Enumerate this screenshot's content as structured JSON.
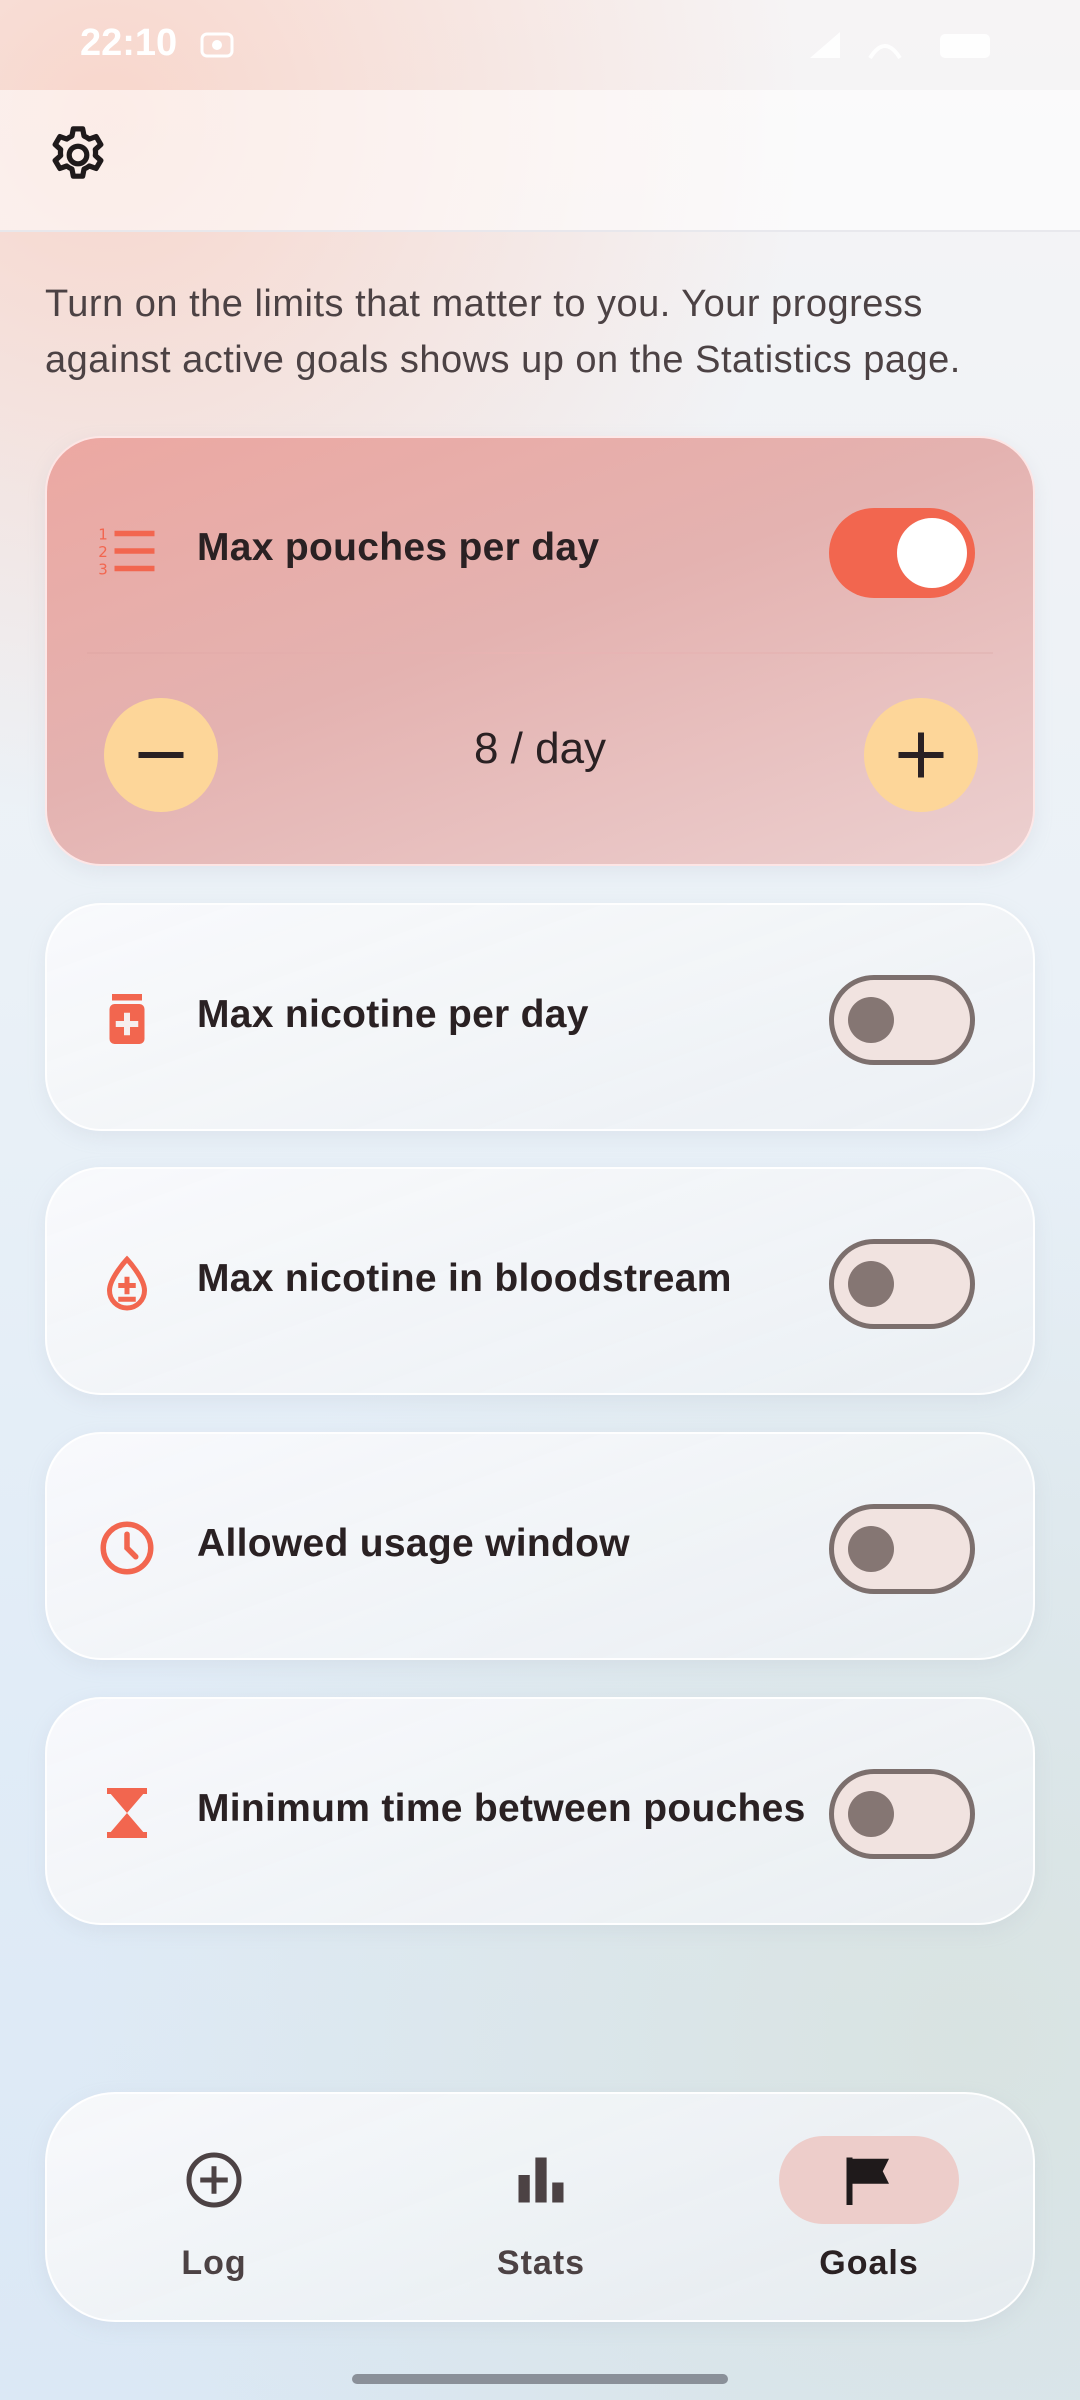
{
  "status_bar": {
    "time": "22:10"
  },
  "intro_text": "Turn on the limits that matter to you. Your progress against active goals shows up on the Statistics page.",
  "goals": [
    {
      "label": "Max pouches per day",
      "icon": "numbered-list-icon",
      "enabled": true,
      "value": "8 / day"
    },
    {
      "label": "Max nicotine per day",
      "icon": "medicine-bottle-icon",
      "enabled": false
    },
    {
      "label": "Max nicotine in bloodstream",
      "icon": "drop-plus-icon",
      "enabled": false
    },
    {
      "label": "Allowed usage window",
      "icon": "clock-icon",
      "enabled": false
    },
    {
      "label": "Minimum time between pouches",
      "icon": "hourglass-icon",
      "enabled": false
    }
  ],
  "nav": {
    "items": [
      {
        "label": "Log",
        "icon": "add-circle-icon",
        "active": false
      },
      {
        "label": "Stats",
        "icon": "bar-chart-icon",
        "active": false
      },
      {
        "label": "Goals",
        "icon": "flag-icon",
        "active": true
      }
    ]
  },
  "colors": {
    "accent": "#f2664f",
    "stepper": "#fdd699",
    "active_card": "#eca8a2",
    "nav_active_pill": "#edcdca"
  }
}
